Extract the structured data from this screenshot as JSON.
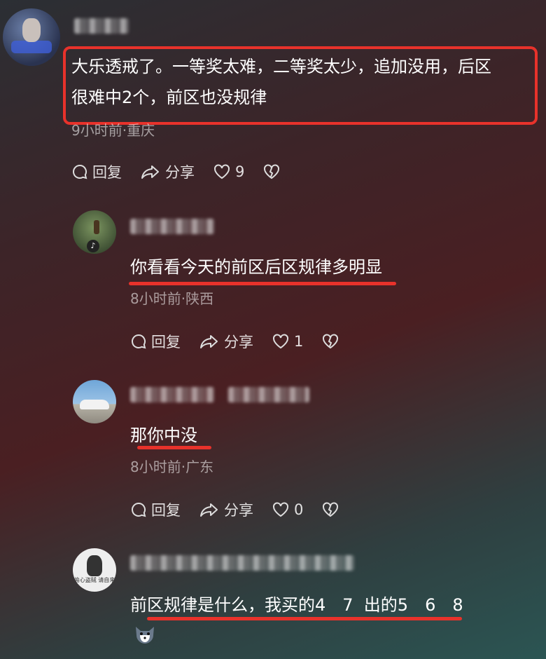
{
  "comments": [
    {
      "text_line1": "大乐透戒了。一等奖太难，二等奖太少，追加没用，后区",
      "text_line2": "很难中2个，前区也没规律",
      "meta": "9小时前·重庆",
      "reply": "回复",
      "share": "分享",
      "likes": "9"
    },
    {
      "text": "你看看今天的前区后区规律多明显",
      "meta": "8小时前·陕西",
      "reply": "回复",
      "share": "分享",
      "likes": "1"
    },
    {
      "text": "那你中没",
      "meta": "8小时前·广东",
      "reply": "回复",
      "share": "分享",
      "likes": "0"
    },
    {
      "text": "前区规律是什么，我买的4　7  出的5　6　8",
      "avatar_caption": "偷心盗贼 请自来"
    }
  ],
  "colors": {
    "highlight": "#e8322b"
  }
}
